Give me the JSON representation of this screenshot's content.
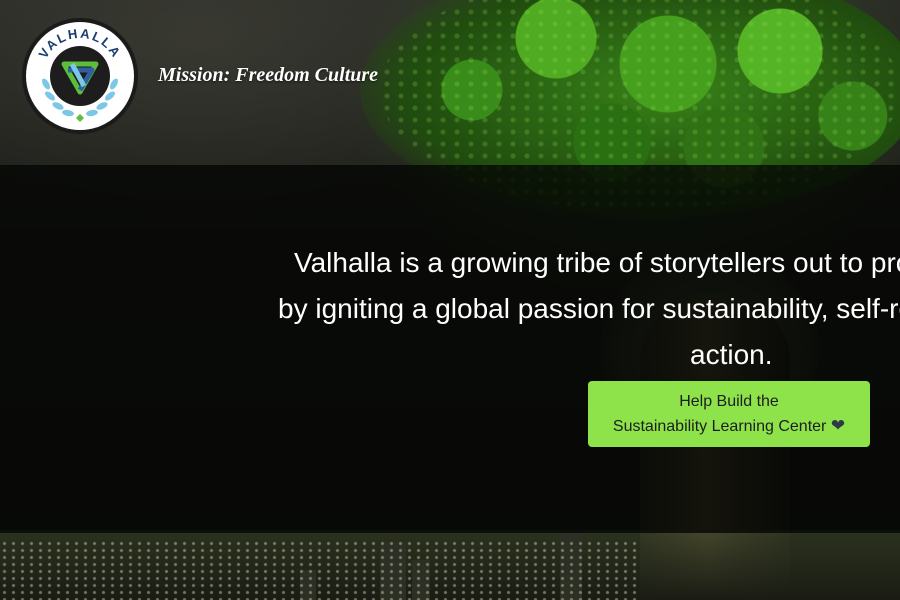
{
  "header": {
    "logo_text": "VALHALLA",
    "tagline": "Mission: Freedom Culture"
  },
  "hero": {
    "line1": "Valhalla is a growing tribe of storytellers out to proli",
    "line2": "by igniting a global passion for sustainability, self-reli",
    "line3": "action."
  },
  "cta": {
    "line1": "Help Build the",
    "line2": "Sustainability Learning Center",
    "icon": "heart-icon"
  },
  "colors": {
    "cta_bg": "#8ee24a",
    "band": "#050604",
    "logo_green": "#5bbf3a",
    "logo_blue": "#2f5f9e"
  }
}
